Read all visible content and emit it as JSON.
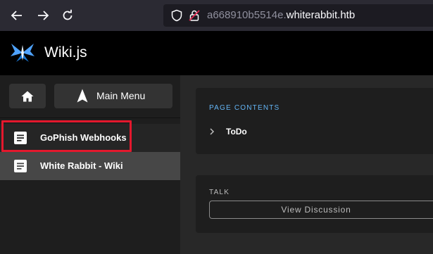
{
  "browser": {
    "url_prefix": "a668910b5514e.",
    "url_host": "whiterabbit.htb"
  },
  "header": {
    "app_title": "Wiki.js"
  },
  "sidebar": {
    "main_menu_label": "Main Menu",
    "items": [
      {
        "label": "GoPhish Webhooks"
      },
      {
        "label": "White Rabbit - Wiki"
      }
    ]
  },
  "toc": {
    "heading": "PAGE CONTENTS",
    "items": [
      {
        "label": "ToDo"
      }
    ]
  },
  "talk": {
    "heading": "TALK",
    "button_label": "View Discussion"
  },
  "colors": {
    "accent_blue": "#64b5f6",
    "highlight_red": "#e3182d"
  }
}
